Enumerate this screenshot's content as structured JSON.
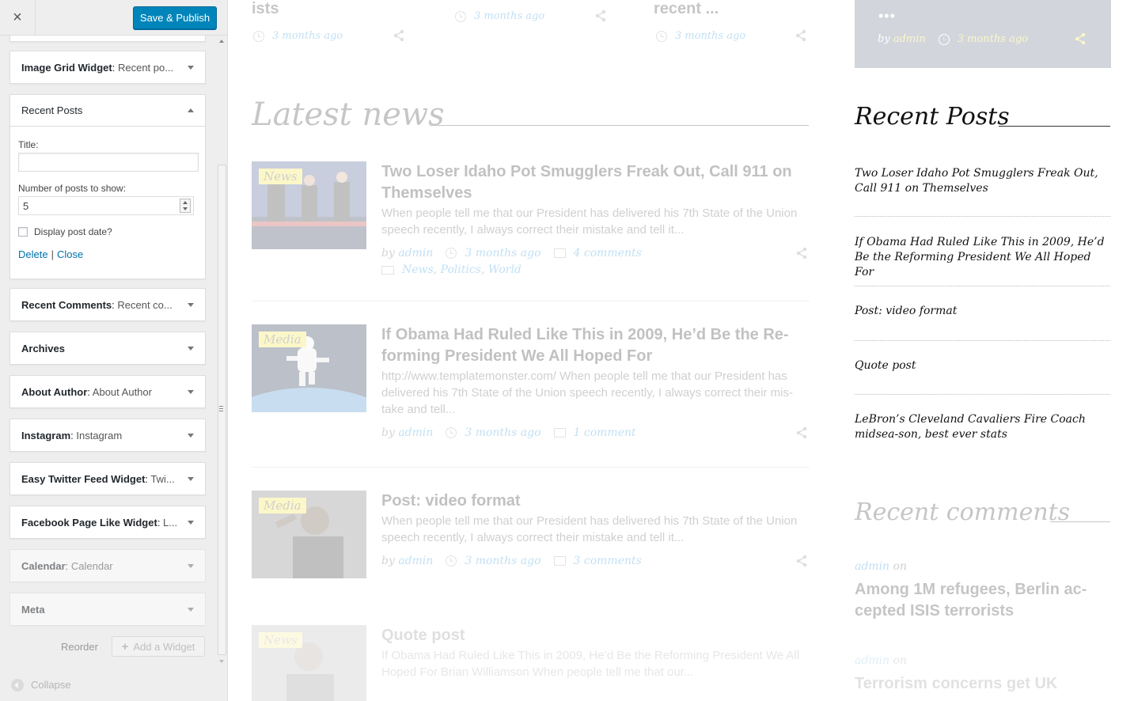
{
  "customizer": {
    "close_glyph": "×",
    "save_label": "Save & Publish",
    "widgets_above": [
      {
        "name": "Image Grid Widget",
        "sub": "Recent po..."
      }
    ],
    "expanded": {
      "name": "Recent Posts",
      "title_label": "Title:",
      "title_value": "",
      "count_label": "Number of posts to show:",
      "count_value": "5",
      "date_label": "Display post date?",
      "date_checked": false,
      "delete_label": "Delete",
      "separator": "|",
      "close_label": "Close"
    },
    "widgets_below": [
      {
        "name": "Recent Comments",
        "sub": "Recent co..."
      },
      {
        "name": "Archives",
        "sub": ""
      },
      {
        "name": "About Author",
        "sub": "About Author"
      },
      {
        "name": "Instagram",
        "sub": "Instagram"
      },
      {
        "name": "Easy Twitter Feed Widget",
        "sub": "Twi..."
      },
      {
        "name": "Facebook Page Like Widget",
        "sub": "L..."
      },
      {
        "name": "Calendar",
        "sub": "Calendar"
      },
      {
        "name": "Meta",
        "sub": ""
      }
    ],
    "reorder_label": "Reorder",
    "add_widget_label": "Add a Widget",
    "collapse_label": "Collapse"
  },
  "preview": {
    "top_row": [
      {
        "title": "ists",
        "time": "3 months ago"
      },
      {
        "title": "",
        "time": "3 months ago"
      },
      {
        "title": "recent ...",
        "time": "3 months ago"
      }
    ],
    "top_card": {
      "dots": "•••",
      "by": "by",
      "author": "admin",
      "time": "3 months ago"
    },
    "latest_title": "Latest news",
    "posts": [
      {
        "category": "News",
        "title": "Two Loser Idaho Pot Smugglers Freak Out, Call 911 on Themselves",
        "excerpt": "When people tell me that our President has delivered his 7th State of the Union speech recently, I always correct their mistake and tell it...",
        "by": "by",
        "author": "admin",
        "time": "3 months ago",
        "comments": "4 comments",
        "cats": [
          "News",
          "Politics",
          "World"
        ]
      },
      {
        "category": "Media",
        "title": "If Obama Had Ruled Like This in 2009, He’d Be the Re-forming President We All Hoped For",
        "excerpt": "http://www.templatemonster.com/ When people tell me that our President has delivered his 7th State of the Union speech recently, I always correct their mis-take and tell...",
        "by": "by",
        "author": "admin",
        "time": "3 months ago",
        "comments": "1 comment"
      },
      {
        "category": "Media",
        "title": "Post: video format",
        "excerpt": "When people tell me that our President has delivered his 7th State of the Union speech recently, I always correct their mistake and tell it...",
        "by": "by",
        "author": "admin",
        "time": "3 months ago",
        "comments": "3 comments"
      },
      {
        "category": "News",
        "title": "Quote post",
        "excerpt": "If Obama Had Ruled Like This in 2009, He’d Be the Reforming President We All Hoped For Brian Williamson When people tell me that our..."
      }
    ],
    "recent_posts_title": "Recent Posts",
    "recent_posts": [
      "Two Loser Idaho Pot Smugglers Freak Out, Call 911 on Themselves",
      "If Obama Had Ruled Like This in 2009, He’d Be the Reforming President We All Hoped For",
      "Post: video format",
      "Quote post",
      "LeBron’s Cleveland Cavaliers Fire Coach midsea-son, best ever stats"
    ],
    "recent_comments_title": "Recent comments",
    "recent_comments": [
      {
        "author": "admin",
        "on": "on",
        "post": "Among 1M refugees, Berlin ac-cepted ISIS terrorists"
      },
      {
        "author": "admin",
        "on": "on",
        "post": "Terrorism concerns get UK"
      }
    ],
    "colors": {
      "accent": "#1e8fd8",
      "badge": "#f2e33a",
      "save_button": "#0085ba"
    }
  }
}
